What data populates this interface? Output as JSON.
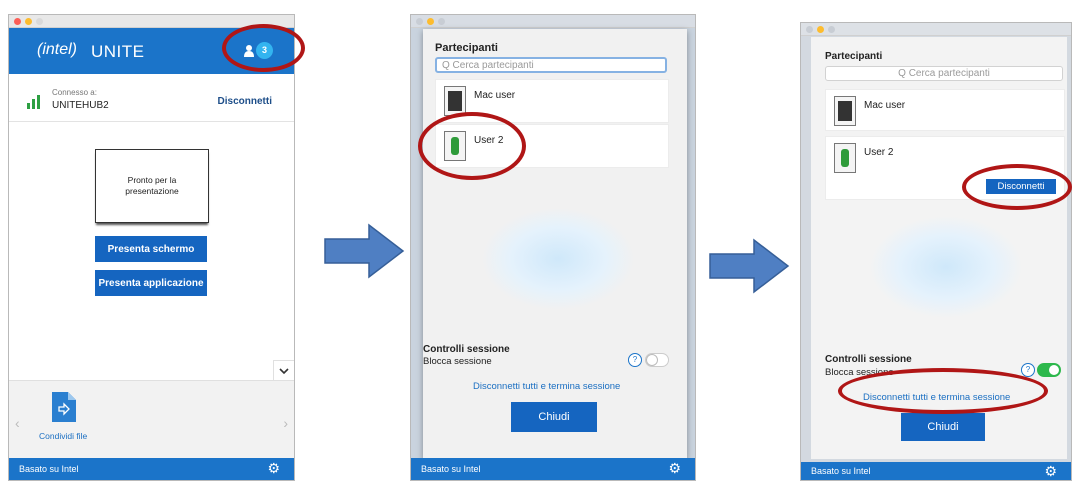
{
  "panel1": {
    "logo_left": "(intel)",
    "logo_right": "UNITE",
    "participant_count": "3",
    "connected_label": "Connesso a:",
    "hub_name": "UNITEHUB2",
    "disconnect": "Disconnetti",
    "preview_text": "Pronto per la presentazione",
    "present_screen": "Presenta schermo",
    "present_app": "Presenta applicazione",
    "share_file": "Condividi file",
    "footer": "Basato su Intel"
  },
  "panel2": {
    "heading": "Partecipanti",
    "search_placeholder": "Q  Cerca partecipanti",
    "participants": [
      "Mac user",
      "User 2"
    ],
    "session_controls": "Controlli sessione",
    "lock_session": "Blocca sessione",
    "help": "?",
    "disconnect_all": "Disconnetti tutti e termina sessione",
    "close": "Chiudi",
    "footer": "Basato su Intel",
    "lock_toggle_on": false
  },
  "panel3": {
    "heading": "Partecipanti",
    "search_placeholder": "Q  Cerca partecipanti",
    "participants": [
      "Mac user",
      "User 2"
    ],
    "disconnect_user": "Disconnetti",
    "session_controls": "Controlli sessione",
    "lock_session": "Blocca sessione",
    "help": "?",
    "disconnect_all": "Disconnetti tutti e termina sessione",
    "close": "Chiudi",
    "footer": "Basato su Intel",
    "lock_toggle_on": true
  },
  "colors": {
    "intel_blue": "#1b74c9",
    "button_blue": "#1565c0",
    "annotation_red": "#b01616",
    "arrow_blue": "#4f7fc3",
    "connected_green": "#2ea043"
  }
}
